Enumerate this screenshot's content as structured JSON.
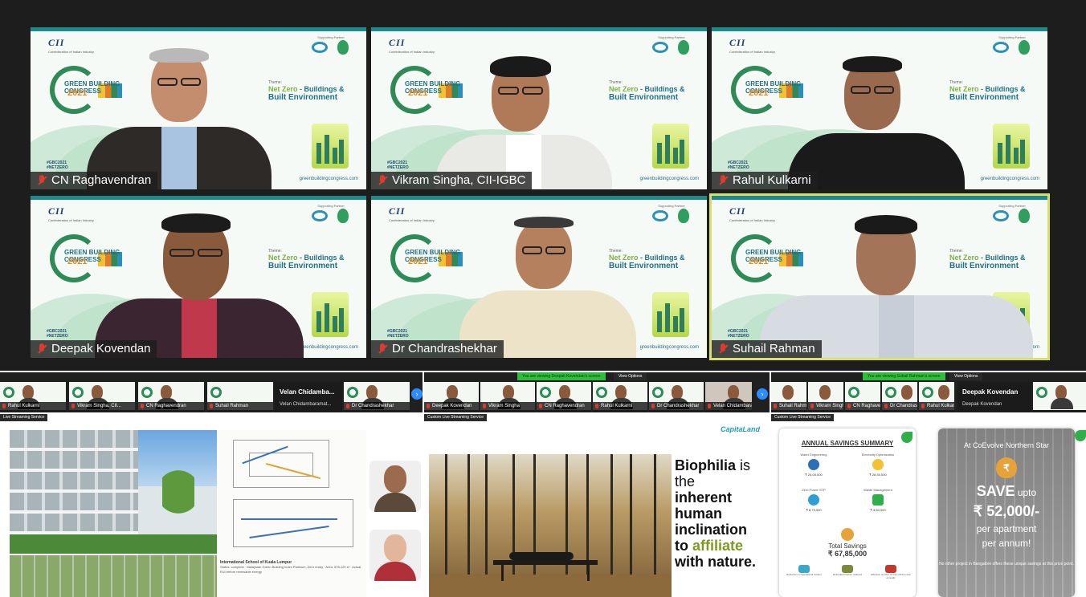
{
  "gallery": {
    "tiles": [
      {
        "name": "CN Raghavendran"
      },
      {
        "name": "Vikram Singha, CII-IGBC"
      },
      {
        "name": "Rahul Kulkarni"
      },
      {
        "name": "Deepak Kovendan"
      },
      {
        "name": "Dr Chandrashekhar"
      },
      {
        "name": "Suhail Rahman"
      }
    ],
    "slide": {
      "org": "CII",
      "org_sub": "Confederation of Indian Industry",
      "partner_label": "Supporting Partner",
      "gbc_line1": "GREEN BUILDING CONGRESS",
      "gbc_year": "2021",
      "theme_label": "Theme:",
      "theme_line1_a": "Net Zero",
      "theme_line1_b": " - Buildings &",
      "theme_line2": "Built Environment",
      "hashtag1": "#GBC2021",
      "hashtag2": "#NETZERO",
      "site": "greenbuildingcongress.com"
    }
  },
  "panel1": {
    "strip_names": [
      "Rahul Kulkarni",
      "Vikram Singha, CII...",
      "CN Raghavendran",
      "Suhail Rahman",
      "Dr Chandrashekhar"
    ],
    "big_name": "Velan Chidamba...",
    "big_name_sub": "Velan Chidambaramat...",
    "service": "Live Streaming Service",
    "slide": {
      "caption_title": "International School of Kuala Lumpur",
      "caption_body": "Status: complete · Malaysian Green Building Index Platinum, Zero ready · Area: 678,129 sf · Actual EUI before renewable energy"
    }
  },
  "panel2": {
    "banner": "You are viewing Deepak Kovendan's screen",
    "view_options": "View Options",
    "strip_names": [
      "Deepak Kovendan",
      "Vikram Singha",
      "CN Raghavendran",
      "Rahul Kulkarni",
      "Dr Chandrashekhar",
      "Velan Chidambaram"
    ],
    "service": "Custom Live Streaming Service",
    "brand": "CapitaLand",
    "quote": {
      "w1": "Biophilia",
      "w1b": " is",
      "w2": "the",
      "w3": "inherent",
      "w4": "human",
      "w5": "inclination",
      "w6a": "to ",
      "w6b": "affiliate",
      "w7": "with nature."
    }
  },
  "panel3": {
    "banner": "You are viewing Suhail Rahman's screen",
    "view_options": "View Options",
    "strip_names": [
      "Suhail Rahman",
      "Vikram Singha",
      "CN Raghavendran",
      "Dr Chandrashekhar",
      "Rahul Kulkarni"
    ],
    "big_name": "Deepak Kovendan",
    "big_name_sub": "Deepak Kovendan",
    "service": "Custom Live Streaming Service",
    "savings": {
      "title": "ANNUAL SAVINGS SUMMARY",
      "items": [
        {
          "label": "Water Engineering",
          "value": "₹ 24,00,000"
        },
        {
          "label": "Electricity Optimization",
          "value": "₹ 28,50,000"
        },
        {
          "label": "Zero Power STP",
          "value": "₹ 8,75,000"
        },
        {
          "label": "Waste Management",
          "value": "₹ 3,60,000"
        }
      ],
      "total_label": "Total Savings",
      "total_value": "₹ 67,85,000",
      "bottom": [
        "Reduction in Operational Carbon",
        "Embodied Carbon reduced",
        "Effective number of Cars off the road annually"
      ]
    },
    "promo": {
      "at": "At CoEvolve Northern Star",
      "save": "SAVE",
      "upto": " upto",
      "amount": "₹ 52,000/-",
      "per_apartment": "per apartment",
      "per_annum": "per annum!",
      "fine": "No other project in Bangalore offers these unique savings at this price point."
    }
  },
  "colors": {
    "gallery_bg": "#1d1d1d",
    "active_outline": "#d8df6a",
    "muted_red": "#e03a2e",
    "brand_teal": "#1d8a8a"
  }
}
